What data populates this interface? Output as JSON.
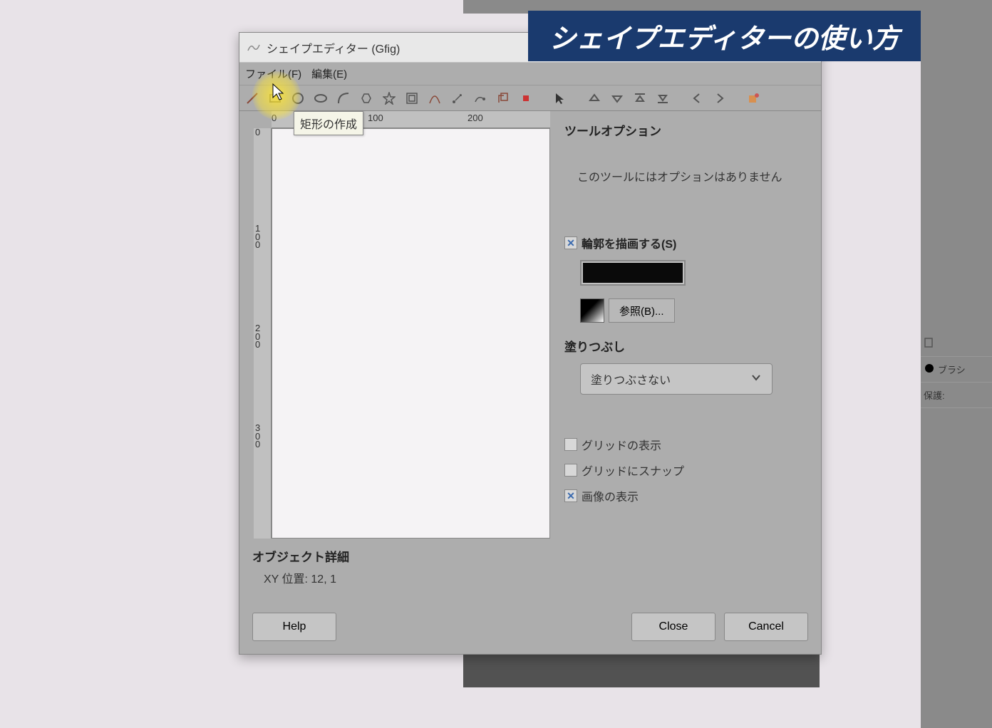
{
  "banner": "シェイプエディターの使い方",
  "window_title": "シェイプエディター (Gfig)",
  "menu": {
    "file": "ファイル(F)",
    "edit": "編集(E)"
  },
  "tooltip": "矩形の作成",
  "ruler_h": {
    "t0": "0",
    "t100": "100",
    "t200": "200"
  },
  "ruler_v": {
    "t0": "0",
    "t100": "100",
    "t200": "200",
    "t300": "300"
  },
  "options": {
    "title": "ツールオプション",
    "no_options": "このツールにはオプションはありません",
    "stroke_label": "輪郭を描画する(S)",
    "browse_label": "参照(B)...",
    "fill_title": "塗りつぶし",
    "fill_value": "塗りつぶさない",
    "grid_show": "グリッドの表示",
    "grid_snap": "グリッドにスナップ",
    "image_show": "画像の表示"
  },
  "details": {
    "title": "オブジェクト詳細",
    "xy_label": "XY 位置: 12, 1"
  },
  "buttons": {
    "help": "Help",
    "close": "Close",
    "cancel": "Cancel"
  },
  "right_panel": {
    "brush": "ブラシ",
    "protect": "保護:"
  }
}
